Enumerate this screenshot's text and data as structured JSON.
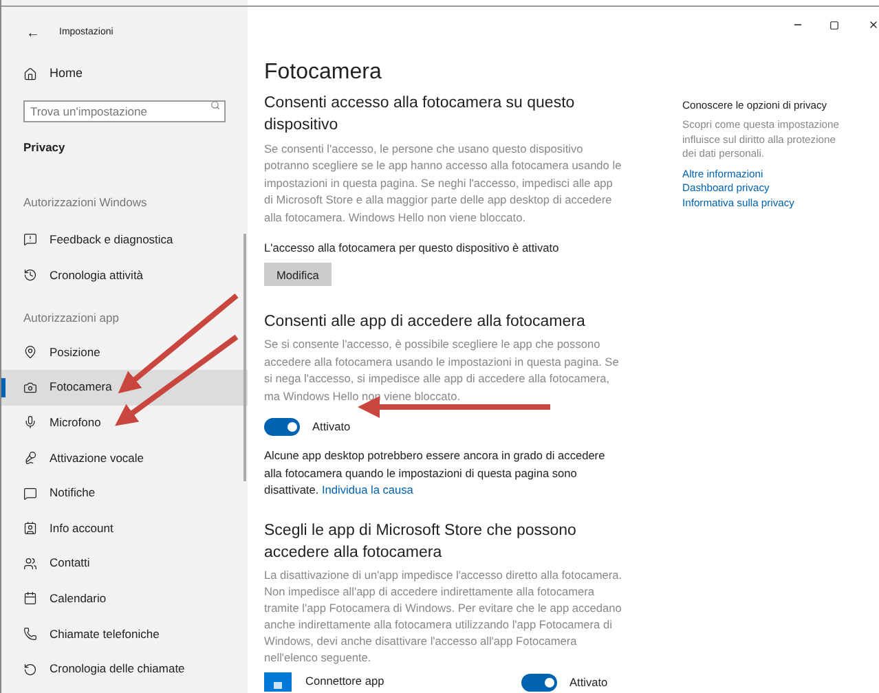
{
  "window": {
    "title": "Impostazioni",
    "back_icon": "←"
  },
  "sidebar": {
    "home": "Home",
    "search": {
      "placeholder": "Trova un'impostazione"
    },
    "section": "Privacy",
    "groups": [
      {
        "heading": "Autorizzazioni Windows",
        "items": [
          {
            "label": "Feedback e diagnostica",
            "selected": false
          },
          {
            "label": "Cronologia attività",
            "selected": false
          }
        ]
      },
      {
        "heading": "Autorizzazioni app",
        "items": [
          {
            "label": "Posizione",
            "selected": false
          },
          {
            "label": "Fotocamera",
            "selected": true
          },
          {
            "label": "Microfono",
            "selected": false
          },
          {
            "label": "Attivazione vocale",
            "selected": false
          },
          {
            "label": "Notifiche",
            "selected": false
          },
          {
            "label": "Info account",
            "selected": false
          },
          {
            "label": "Contatti",
            "selected": false
          },
          {
            "label": "Calendario",
            "selected": false
          },
          {
            "label": "Chiamate telefoniche",
            "selected": false
          },
          {
            "label": "Cronologia delle chiamate",
            "selected": false
          }
        ]
      }
    ]
  },
  "main": {
    "title": "Fotocamera",
    "device_section": {
      "heading": "Consenti accesso alla fotocamera su questo dispositivo",
      "description": "Se consenti l'accesso, le persone che usano questo dispositivo potranno scegliere se le app hanno accesso alla fotocamera usando le impostazioni in questa pagina. Se neghi l'accesso, impedisci alle app di Microsoft Store e alla maggior parte delle app desktop di accedere alla fotocamera. Windows Hello non viene bloccato.",
      "status": "L'accesso alla fotocamera per questo dispositivo è attivato",
      "button": "Modifica"
    },
    "apps_section": {
      "heading": "Consenti alle app di accedere alla fotocamera",
      "description": "Se si consente l'accesso, è possibile scegliere le app che possono accedere alla fotocamera usando le impostazioni in questa pagina. Se si nega l'accesso, si impedisce alle app di accedere alla fotocamera, ma Windows Hello non viene bloccato.",
      "toggle": {
        "on": true,
        "label": "Attivato"
      },
      "note": "Alcune app desktop potrebbero essere ancora in grado di accedere alla fotocamera quando le impostazioni di questa pagina sono disattivate.",
      "link": "Individua la causa"
    },
    "store_section": {
      "heading": "Scegli le app di Microsoft Store che possono accedere alla fotocamera",
      "description": "La disattivazione di un'app impedisce l'accesso diretto alla fotocamera. Non impedisce all'app di accedere indirettamente alla fotocamera tramite l'app Fotocamera di Windows. Per evitare che le app accedano anche indirettamente alla fotocamera utilizzando l'app Fotocamera di Windows, devi anche disattivare l'accesso all'app Fotocamera nell'elenco seguente.",
      "apps": [
        {
          "name": "Connettore app",
          "on": true,
          "label": "Attivato"
        }
      ]
    }
  },
  "aside": {
    "heading": "Conoscere le opzioni di privacy",
    "description": "Scopri come questa impostazione influisce sul diritto alla protezione dei dati personali.",
    "links": [
      "Altre informazioni",
      "Dashboard privacy",
      "Informativa sulla privacy"
    ]
  }
}
